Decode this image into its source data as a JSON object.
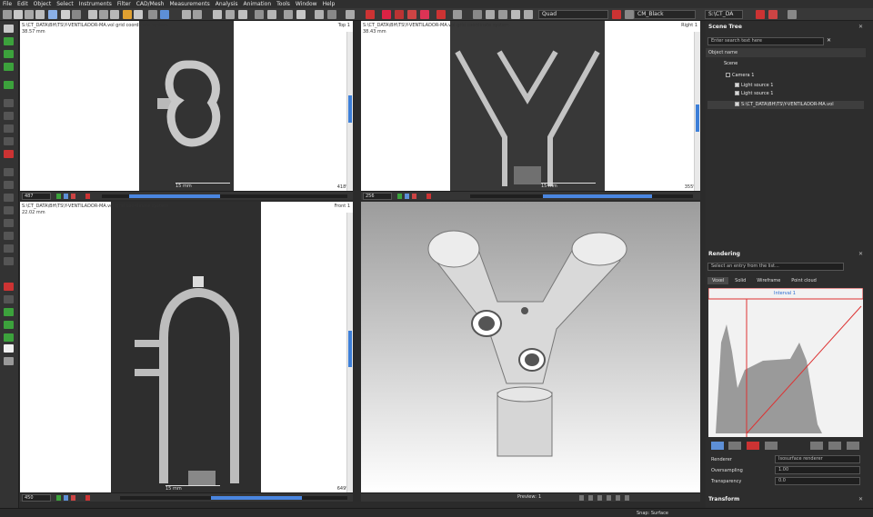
{
  "menu": [
    "File",
    "Edit",
    "Object",
    "Select",
    "Instruments",
    "Filter",
    "CAD/Mesh",
    "Measurements",
    "Analysis",
    "Animation",
    "Tools",
    "Window",
    "Help"
  ],
  "toolbar": {
    "layout_combo": "Quad",
    "colormap_combo": "CM_Black",
    "path_combo": "S:\\CT_DA"
  },
  "views": {
    "top": {
      "title": "S:\\CT_DATA\\BH\\TS\\Y-VENTILADOR-MA.vol grid coordinate system",
      "subtitle": "38.57 mm",
      "label": "Top 1",
      "scale": "15 mm",
      "slice": "487",
      "zoom": "418%"
    },
    "right": {
      "title": "S:\\CT_DATA\\BH\\TS\\Y-VENTILADOR-MA.vol grid coordinate system",
      "subtitle": "38.43 mm",
      "label": "Right 1",
      "scale": "15 mm",
      "slice": "256",
      "zoom": "355%"
    },
    "front": {
      "title": "S:\\CT_DATA\\BH\\TS\\Y-VENTILADOR-MA.vol grid coordinate system",
      "subtitle": "22.02 mm",
      "label": "Front 1",
      "scale": "15 mm",
      "slice": "450",
      "zoom": "649%"
    },
    "render3d": {
      "preview_label": "Preview:",
      "preview_value": "1"
    }
  },
  "scene_tree": {
    "title": "Scene Tree",
    "search_placeholder": "Enter search text here",
    "column": "Object name",
    "items": [
      {
        "label": "Scene",
        "checked": false
      },
      {
        "label": "Camera 1",
        "checked": false
      },
      {
        "label": "Light source 1",
        "checked": true
      },
      {
        "label": "Light source 1",
        "checked": true
      },
      {
        "label": "S:\\CT_DATA\\BH\\TS\\Y-VENTILADOR-MA.vol",
        "checked": true
      }
    ]
  },
  "rendering": {
    "title": "Rendering",
    "select_placeholder": "Select an entry from the list...",
    "tabs": [
      "Voxel",
      "Solid",
      "Wireframe",
      "Point cloud"
    ],
    "interval_label": "Interval 1",
    "renderer_label": "Renderer",
    "renderer_value": "Isosurface renderer",
    "oversampling_label": "Oversampling",
    "oversampling_value": "1.00",
    "transparency_label": "Transparency",
    "transparency_value": "0.0"
  },
  "transform": {
    "title": "Transform"
  },
  "status": {
    "snap": "Snap: Surface"
  },
  "colors": {
    "accent": "#3d7fd8",
    "panel": "#2d2d2d",
    "viewport": "#ffffff"
  }
}
